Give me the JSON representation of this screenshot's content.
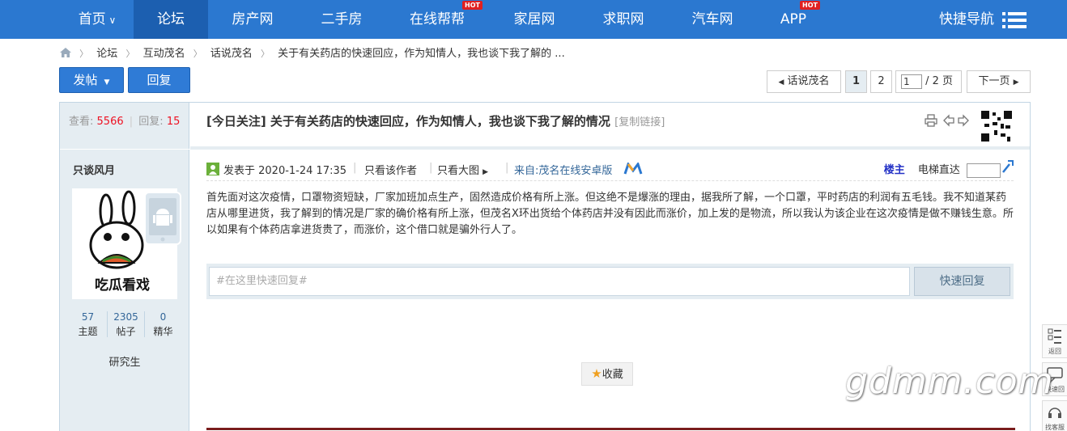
{
  "nav": {
    "items": [
      {
        "label": "首页",
        "hot": false
      },
      {
        "label": "论坛",
        "hot": false,
        "active": true
      },
      {
        "label": "房产网",
        "hot": false
      },
      {
        "label": "二手房",
        "hot": false
      },
      {
        "label": "在线帮帮",
        "hot": true
      },
      {
        "label": "家居网",
        "hot": false
      },
      {
        "label": "求职网",
        "hot": false
      },
      {
        "label": "汽车网",
        "hot": false
      },
      {
        "label": "APP",
        "hot": true
      }
    ],
    "hot_label": "HOT",
    "quick_nav": "快捷导航"
  },
  "breadcrumb": [
    "论坛",
    "互动茂名",
    "话说茂名",
    "关于有关药店的快速回应，作为知情人，我也谈下我了解的 ..."
  ],
  "actions": {
    "post": "发帖",
    "reply": "回复"
  },
  "pager": {
    "back": "话说茂名",
    "pages": [
      "1",
      "2"
    ],
    "current_input": "1",
    "total": "/ 2 页",
    "next": "下一页"
  },
  "stats": {
    "views_label": "查看:",
    "views": "5566",
    "replies_label": "回复:",
    "replies": "15"
  },
  "thread": {
    "title": "[今日关注] 关于有关药店的快速回应，作为知情人，我也谈下我了解的情况",
    "copy_link": "[复制链接]"
  },
  "author": {
    "name": "只谈风月",
    "avatar_caption": "吃瓜看戏",
    "topics": "57",
    "topics_label": "主题",
    "posts": "2305",
    "posts_label": "帖子",
    "digest": "0",
    "digest_label": "精华",
    "rank": "研究生"
  },
  "post": {
    "posted_at": "发表于 2020-1-24 17:35",
    "only_author": "只看该作者",
    "big_image": "只看大图",
    "source": "来自:茂名在线安卓版",
    "floor": "楼主",
    "elevator": "电梯直达",
    "content": "首先面对这次疫情，口罩物资短缺，厂家加班加点生产，固然造成价格有所上涨。但这绝不是爆涨的理由，据我所了解，一个口罩，平时药店的利润有五毛钱。我不知道某药店从哪里进货，我了解到的情况是厂家的确价格有所上涨，但茂名X环出货给个体药店并没有因此而涨价，加上发的是物流，所以我认为该企业在这次疫情是做不赚钱生意。所以如果有个体药店拿进货贵了，而涨价，这个借口就是骗外行人了。"
  },
  "quick_reply": {
    "placeholder": "#在这里快速回复#",
    "button": "快速回复"
  },
  "favorite": "收藏",
  "rail": {
    "back": "返回",
    "quick_reply": "快速回",
    "service": "找客服"
  },
  "watermark": "gdmm.com",
  "colors": {
    "nav_bg": "#2b78d0",
    "nav_active": "#1c5fb0",
    "side_bg": "#e5edf2",
    "accent_red": "#e11122",
    "link_blue": "#336699"
  }
}
